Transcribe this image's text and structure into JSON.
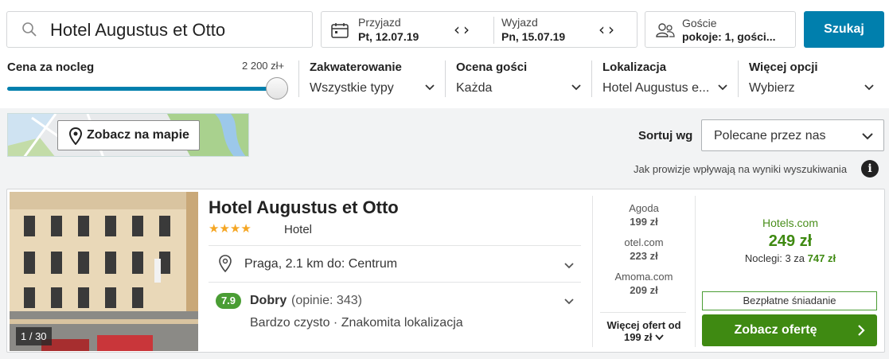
{
  "search": {
    "query": "Hotel Augustus et Otto",
    "checkin_label": "Przyjazd",
    "checkin_value": "Pt, 12.07.19",
    "checkout_label": "Wyjazd",
    "checkout_value": "Pn, 15.07.19",
    "guests_label": "Goście",
    "guests_value": "pokoje: 1, gości...",
    "search_button": "Szukaj"
  },
  "filters": {
    "price_label": "Cena za nocleg",
    "price_max": "2 200 zł+",
    "price_slider_fraction": 1.0,
    "accommodation_label": "Zakwaterowanie",
    "accommodation_value": "Wszystkie typy",
    "rating_label": "Ocena gości",
    "rating_value": "Każda",
    "location_label": "Lokalizacja",
    "location_value": "Hotel Augustus e...",
    "more_label": "Więcej opcji",
    "more_value": "Wybierz"
  },
  "toolbar": {
    "map_button": "Zobacz na mapie",
    "sort_label": "Sortuj wg",
    "sort_value": "Polecane przez nas",
    "info_text": "Jak prowizje wpływają na wyniki wyszukiwania",
    "info_icon": "i"
  },
  "result": {
    "name": "Hotel Augustus et Otto",
    "stars": "★★★★",
    "star_count": 4,
    "type": "Hotel",
    "location": "Praga, 2.1 km do: Centrum",
    "rating_score": "7.9",
    "rating_label": "Dobry",
    "rating_count": "(opinie: 343)",
    "rating_desc": "Bardzo czysto · Znakomita lokalizacja",
    "photo_count": "1 / 30",
    "providers": [
      {
        "name": "Agoda",
        "price": "199 zł"
      },
      {
        "name": "otel.com",
        "price": "223 zł"
      },
      {
        "name": "Amoma.com",
        "price": "209 zł"
      }
    ],
    "more_offers_line1": "Więcej ofert od",
    "more_offers_line2": "199 zł",
    "best_site": "Hotels.com",
    "best_price": "249 zł",
    "best_nights_prefix": "Noclegi: 3 za",
    "best_nights_total": "747 zł",
    "breakfast": "Bezpłatne śniadanie",
    "offer_button": "Zobacz ofertę"
  },
  "colors": {
    "primary_blue": "#007fad",
    "green": "#3f8a12",
    "rating_green": "#4a9d34",
    "star": "#f5a623"
  }
}
